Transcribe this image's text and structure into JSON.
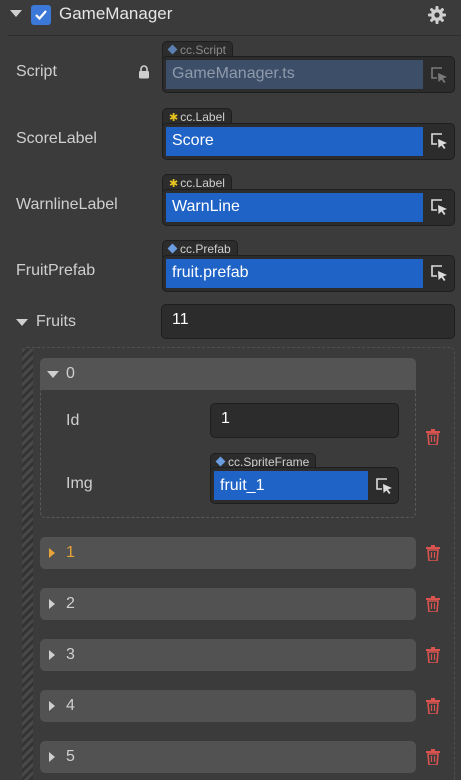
{
  "component": {
    "title": "GameManager",
    "enabled": true
  },
  "props": {
    "script": {
      "label": "Script",
      "tag": "cc.Script",
      "value": "GameManager.ts"
    },
    "score_label": {
      "label": "ScoreLabel",
      "tag": "cc.Label",
      "value": "Score"
    },
    "warnline_label": {
      "label": "WarnlineLabel",
      "tag": "cc.Label",
      "value": "WarnLine"
    },
    "fruit_prefab": {
      "label": "FruitPrefab",
      "tag": "cc.Prefab",
      "value": "fruit.prefab"
    },
    "fruits": {
      "label": "Fruits",
      "count": "11"
    }
  },
  "fruits_items": {
    "i0": {
      "index": "0",
      "id_label": "Id",
      "id_value": "1",
      "img_label": "Img",
      "img_tag": "cc.SpriteFrame",
      "img_value": "fruit_1"
    },
    "i1": "1",
    "i2": "2",
    "i3": "3",
    "i4": "4",
    "i5": "5"
  },
  "colors": {
    "accent": "#1f63c6",
    "highlight": "#e8a23a",
    "delete": "#d9534f"
  }
}
